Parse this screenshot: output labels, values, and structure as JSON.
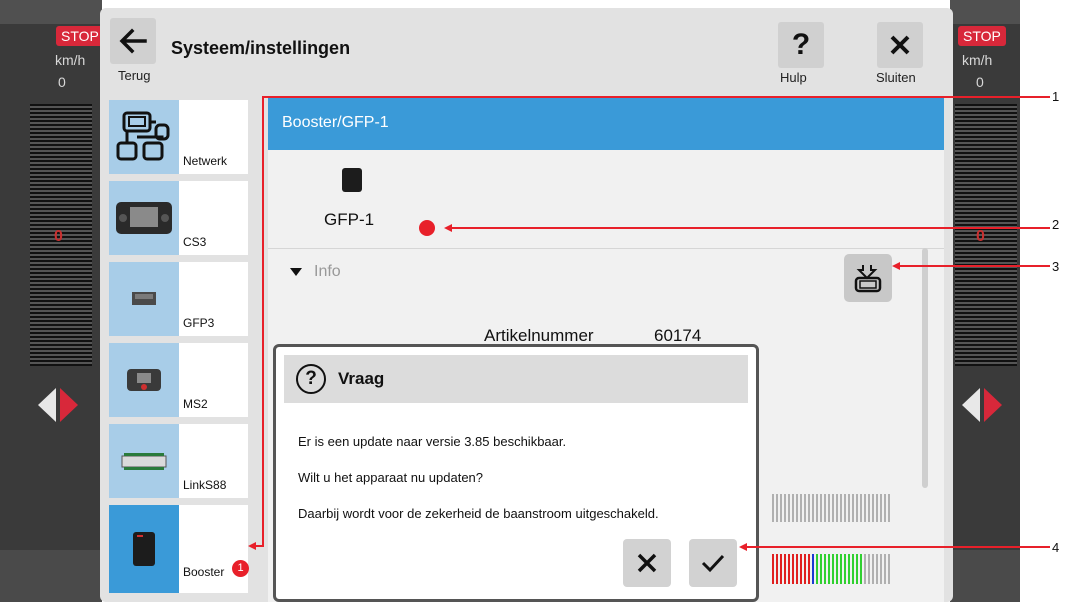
{
  "window": {
    "title": "Systeem/instellingen",
    "back_label": "Terug",
    "help_label": "Hulp",
    "close_label": "Sluiten"
  },
  "cab_left": {
    "stop": "STOP",
    "unit": "km/h",
    "speed": "0",
    "speed_marker": "0"
  },
  "cab_right": {
    "stop": "STOP",
    "unit": "km/h",
    "speed": "0",
    "speed_marker": "0"
  },
  "sidebar": {
    "items": [
      {
        "label": "Netwerk",
        "icon": "network-icon"
      },
      {
        "label": "CS3",
        "icon": "cs3-device-icon"
      },
      {
        "label": "GFP3",
        "icon": "gfp3-device-icon"
      },
      {
        "label": "MS2",
        "icon": "ms2-device-icon"
      },
      {
        "label": "LinkS88",
        "icon": "links88-device-icon"
      },
      {
        "label": "Booster",
        "icon": "booster-device-icon",
        "selected": true
      }
    ]
  },
  "content": {
    "header": "Booster/GFP-1",
    "device_name": "GFP-1",
    "info_label": "Info",
    "article_label": "Artikelnummer",
    "article_value": "60174"
  },
  "dialog": {
    "title": "Vraag",
    "lines": [
      "Er is een update naar versie 3.85 beschikbaar.",
      "Wilt u het apparaat nu updaten?",
      "Daarbij wordt voor de zekerheid de baanstroom uitgeschakeld."
    ]
  },
  "annotations": [
    "1",
    "2",
    "3",
    "4"
  ],
  "badge_value": "1",
  "colors": {
    "accent_blue": "#3a9ad8",
    "stop_red": "#d8283a",
    "annotation_red": "#e8202a"
  }
}
